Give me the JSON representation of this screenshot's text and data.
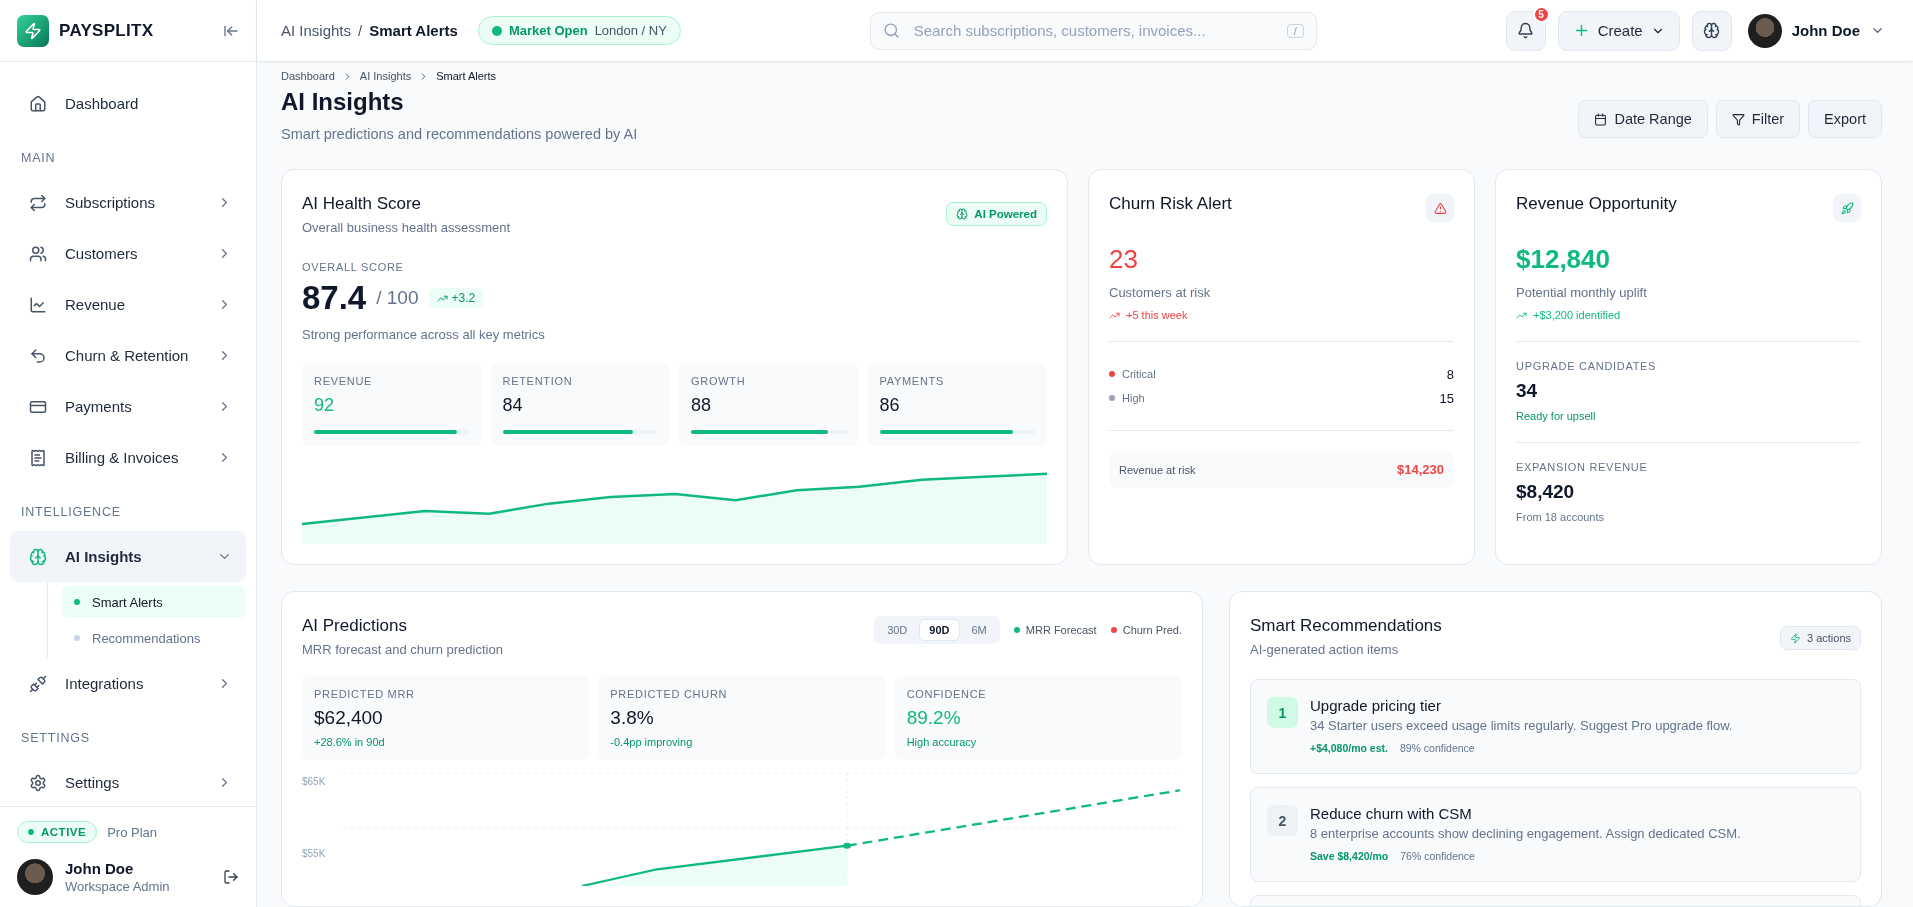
{
  "sidebar": {
    "brand": "PAYSPLITX",
    "top_items": [
      {
        "label": "Dashboard",
        "selected": false
      }
    ],
    "sections": [
      {
        "title": "MAIN",
        "items": [
          {
            "label": "Subscriptions",
            "selected": false,
            "expanded": false
          },
          {
            "label": "Customers",
            "selected": false,
            "expanded": false
          },
          {
            "label": "Revenue",
            "selected": false,
            "expanded": false
          },
          {
            "label": "Churn & Retention",
            "selected": false,
            "expanded": false
          },
          {
            "label": "Payments",
            "selected": false,
            "expanded": false
          },
          {
            "label": "Billing & Invoices",
            "selected": false,
            "expanded": false
          }
        ]
      },
      {
        "title": "INTELLIGENCE",
        "items": [
          {
            "label": "AI Insights",
            "selected": true,
            "expanded": true,
            "children": [
              {
                "label": "Smart Alerts",
                "selected": true
              },
              {
                "label": "Recommendations",
                "selected": false
              }
            ]
          },
          {
            "label": "Integrations",
            "selected": false,
            "expanded": false
          }
        ]
      },
      {
        "title": "SETTINGS",
        "items": [
          {
            "label": "Settings",
            "selected": false,
            "expanded": false
          }
        ]
      }
    ],
    "plan": {
      "status": "ACTIVE",
      "name": "Pro Plan"
    },
    "user": {
      "name": "John Doe",
      "role": "Workspace Admin"
    }
  },
  "header": {
    "breadcrumb": [
      "AI Insights",
      "Smart Alerts"
    ],
    "separator": "/",
    "market": {
      "status": "Market Open",
      "location": "London / NY"
    },
    "search": {
      "placeholder": "Search subscriptions, customers, invoices...",
      "shortcut": "/"
    },
    "notifications": "5",
    "create_label": "Create",
    "user": "John Doe"
  },
  "page": {
    "breadcrumb": [
      "Dashboard",
      "AI Insights",
      "Smart Alerts"
    ],
    "title": "AI Insights",
    "subtitle": "Smart predictions and recommendations powered by AI",
    "actions": [
      "Date Range",
      "Filter",
      "Export"
    ]
  },
  "health": {
    "title": "AI Health Score",
    "subtitle": "Overall business health assessment",
    "badge": "AI Powered",
    "score_label": "OVERALL SCORE",
    "score": "87.4",
    "max": "/ 100",
    "delta": "+3.2",
    "note": "Strong performance across all key metrics",
    "metrics": [
      {
        "label": "REVENUE",
        "value": "92",
        "level": 0.92,
        "highlighted": true
      },
      {
        "label": "RETENTION",
        "value": "84",
        "level": 0.84,
        "highlighted": false
      },
      {
        "label": "GROWTH",
        "value": "88",
        "level": 0.88,
        "highlighted": false
      },
      {
        "label": "PAYMENTS",
        "value": "86",
        "level": 0.86,
        "highlighted": false
      }
    ]
  },
  "churn": {
    "title": "Churn Risk Alert",
    "value": "23",
    "caption": "Customers at risk",
    "trend": "+5 this week",
    "breakdown": [
      {
        "label": "Critical",
        "count": "8",
        "color": "#ef4444"
      },
      {
        "label": "High",
        "count": "15",
        "color": "#9ca3af"
      }
    ],
    "footer_label": "Revenue at risk",
    "footer_value": "$14,230"
  },
  "revenue": {
    "title": "Revenue Opportunity",
    "value": "$12,840",
    "caption": "Potential monthly uplift",
    "trend": "+$3,200 identified",
    "sections": [
      {
        "label": "UPGRADE CANDIDATES",
        "value": "34",
        "note": "Ready for upsell",
        "kind": "positive"
      },
      {
        "label": "EXPANSION REVENUE",
        "value": "$8,420",
        "note": "From 18 accounts",
        "kind": "muted"
      }
    ]
  },
  "predictions": {
    "title": "AI Predictions",
    "subtitle": "MRR forecast and churn prediction",
    "ranges": [
      {
        "label": "30D",
        "selected": false
      },
      {
        "label": "90D",
        "selected": true
      },
      {
        "label": "6M",
        "selected": false
      }
    ],
    "legend": [
      {
        "label": "MRR Forecast",
        "color": "#10b981"
      },
      {
        "label": "Churn Pred.",
        "color": "#ef4444"
      }
    ],
    "stats": [
      {
        "label": "PREDICTED MRR",
        "value": "$62,400",
        "note": "+28.6% in 90d",
        "highlighted": false
      },
      {
        "label": "PREDICTED CHURN",
        "value": "3.8%",
        "note": "-0.4pp improving",
        "highlighted": false
      },
      {
        "label": "CONFIDENCE",
        "value": "89.2%",
        "note": "High accuracy",
        "highlighted": true
      }
    ],
    "axis_labels": [
      "$65K",
      "$55K"
    ]
  },
  "recommendations": {
    "title": "Smart Recommendations",
    "subtitle": "AI-generated action items",
    "badge": "3 actions",
    "items": [
      {
        "number": "1",
        "title": "Upgrade pricing tier",
        "description": "34 Starter users exceed usage limits regularly. Suggest Pro upgrade flow.",
        "impact": "+$4,080/mo est.",
        "confidence": "89% confidence",
        "highlighted": true
      },
      {
        "number": "2",
        "title": "Reduce churn with CSM",
        "description": "8 enterprise accounts show declining engagement. Assign dedicated CSM.",
        "impact": "Save $8,420/mo",
        "confidence": "76% confidence",
        "highlighted": false
      }
    ]
  }
}
